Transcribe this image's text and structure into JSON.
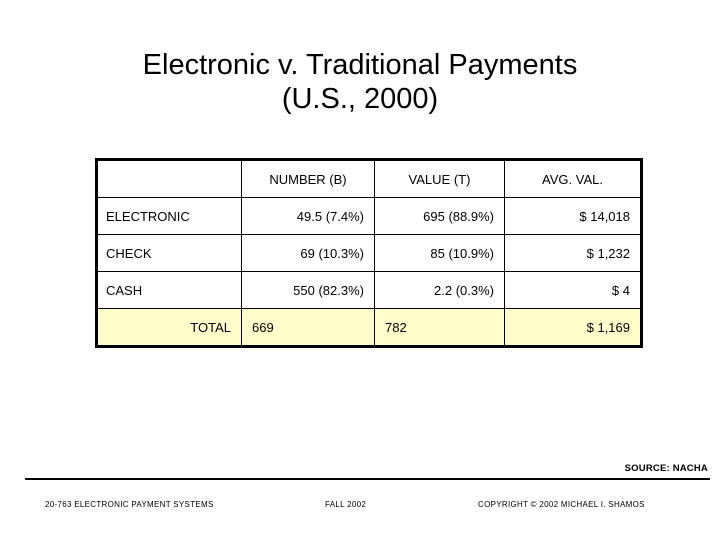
{
  "slide": {
    "title_line1": "Electronic v. Traditional Payments",
    "title_line2": "(U.S., 2000)"
  },
  "table": {
    "columns": [
      "",
      "NUMBER (B)",
      "VALUE (T)",
      "AVG. VAL."
    ],
    "rows": [
      {
        "label": "ELECTRONIC",
        "number": "49.5 (7.4%)",
        "value": "695  (88.9%)",
        "avg": "$ 14,018"
      },
      {
        "label": "CHECK",
        "number": "69  (10.3%)",
        "value": "85  (10.9%)",
        "avg": "$ 1,232"
      },
      {
        "label": "CASH",
        "number": "550  (82.3%)",
        "value": "2.2 (0.3%)",
        "avg": "$ 4"
      }
    ],
    "total": {
      "label": "TOTAL",
      "number": "669",
      "value": "782",
      "avg": "$ 1,169"
    },
    "total_row_color": "#ffffcc"
  },
  "source_note": "SOURCE: NACHA",
  "footer": {
    "left": "20-763 ELECTRONIC PAYMENT SYSTEMS",
    "center": "FALL 2002",
    "right": "COPYRIGHT © 2002 MICHAEL I. SHAMOS"
  }
}
